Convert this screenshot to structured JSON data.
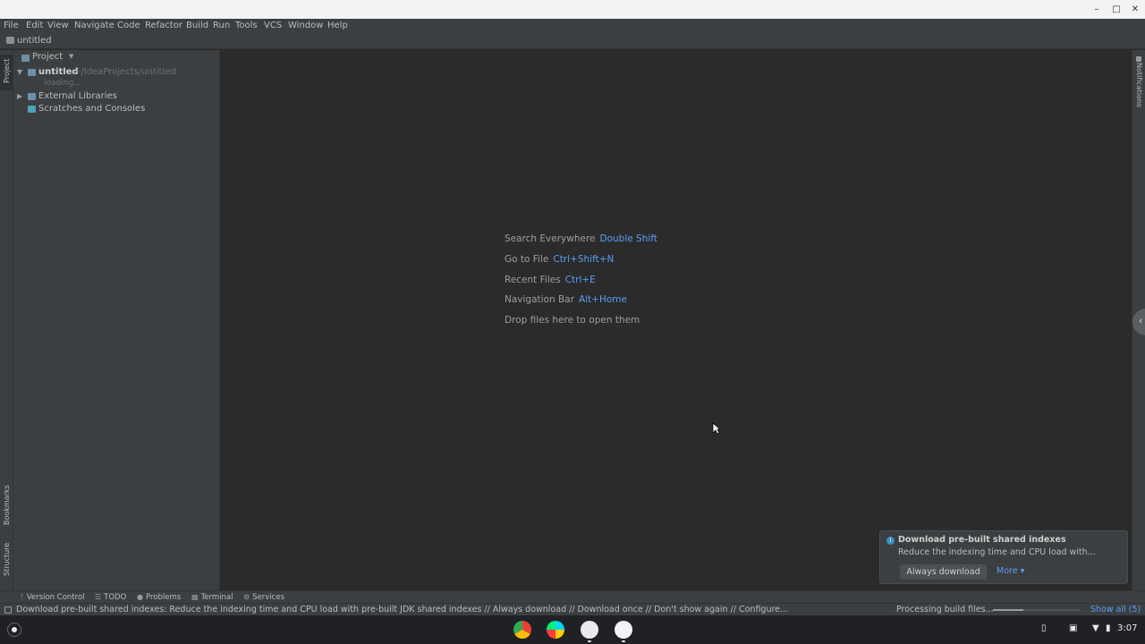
{
  "window": {
    "controls": [
      "minimize",
      "maximize",
      "close"
    ]
  },
  "menu": [
    "File",
    "Edit",
    "View",
    "Navigate",
    "Code",
    "Refactor",
    "Build",
    "Run",
    "Tools",
    "VCS",
    "Window",
    "Help"
  ],
  "navbar": {
    "crumb": "untitled"
  },
  "left_stripe": {
    "project": "Project",
    "bookmarks": "Bookmarks",
    "structure": "Structure"
  },
  "right_stripe": {
    "notifications": "Notifications"
  },
  "project_panel": {
    "title": "Project",
    "tree": {
      "root_name": "untitled",
      "root_path": "~/IdeaProjects/untitled",
      "loading": "loading...",
      "external_libraries": "External Libraries",
      "scratches": "Scratches and Consoles"
    }
  },
  "editor_hints": [
    {
      "label": "Search Everywhere",
      "shortcut": "Double Shift"
    },
    {
      "label": "Go to File",
      "shortcut": "Ctrl+Shift+N"
    },
    {
      "label": "Recent Files",
      "shortcut": "Ctrl+E"
    },
    {
      "label": "Navigation Bar",
      "shortcut": "Alt+Home"
    },
    {
      "label": "Drop files here to open them",
      "shortcut": ""
    }
  ],
  "notification": {
    "title": "Download pre-built shared indexes",
    "body": "Reduce the indexing time and CPU load with...",
    "button": "Always download",
    "more": "More ▾"
  },
  "tool_windows": [
    {
      "label": "Version Control",
      "icon": "branch-icon"
    },
    {
      "label": "TODO",
      "icon": "list-icon"
    },
    {
      "label": "Problems",
      "icon": "problems-icon"
    },
    {
      "label": "Terminal",
      "icon": "terminal-icon"
    },
    {
      "label": "Services",
      "icon": "services-icon"
    }
  ],
  "statusbar": {
    "message": "Download pre-built shared indexes: Reduce the indexing time and CPU load with pre-built JDK shared indexes // Always download // Download once // Don't show again // Configure...",
    "process": "Processing build files...",
    "progress": 0.35,
    "show_all": "Show all (5)"
  },
  "shelf": {
    "apps": [
      "chrome",
      "play-store",
      "files",
      "linux-terminal"
    ],
    "time": "3:07"
  },
  "colors": {
    "accent_link": "#589df6",
    "panel_bg": "#3c3f41",
    "editor_bg": "#2b2b2b",
    "folder_blue": "#6e8fa8"
  }
}
